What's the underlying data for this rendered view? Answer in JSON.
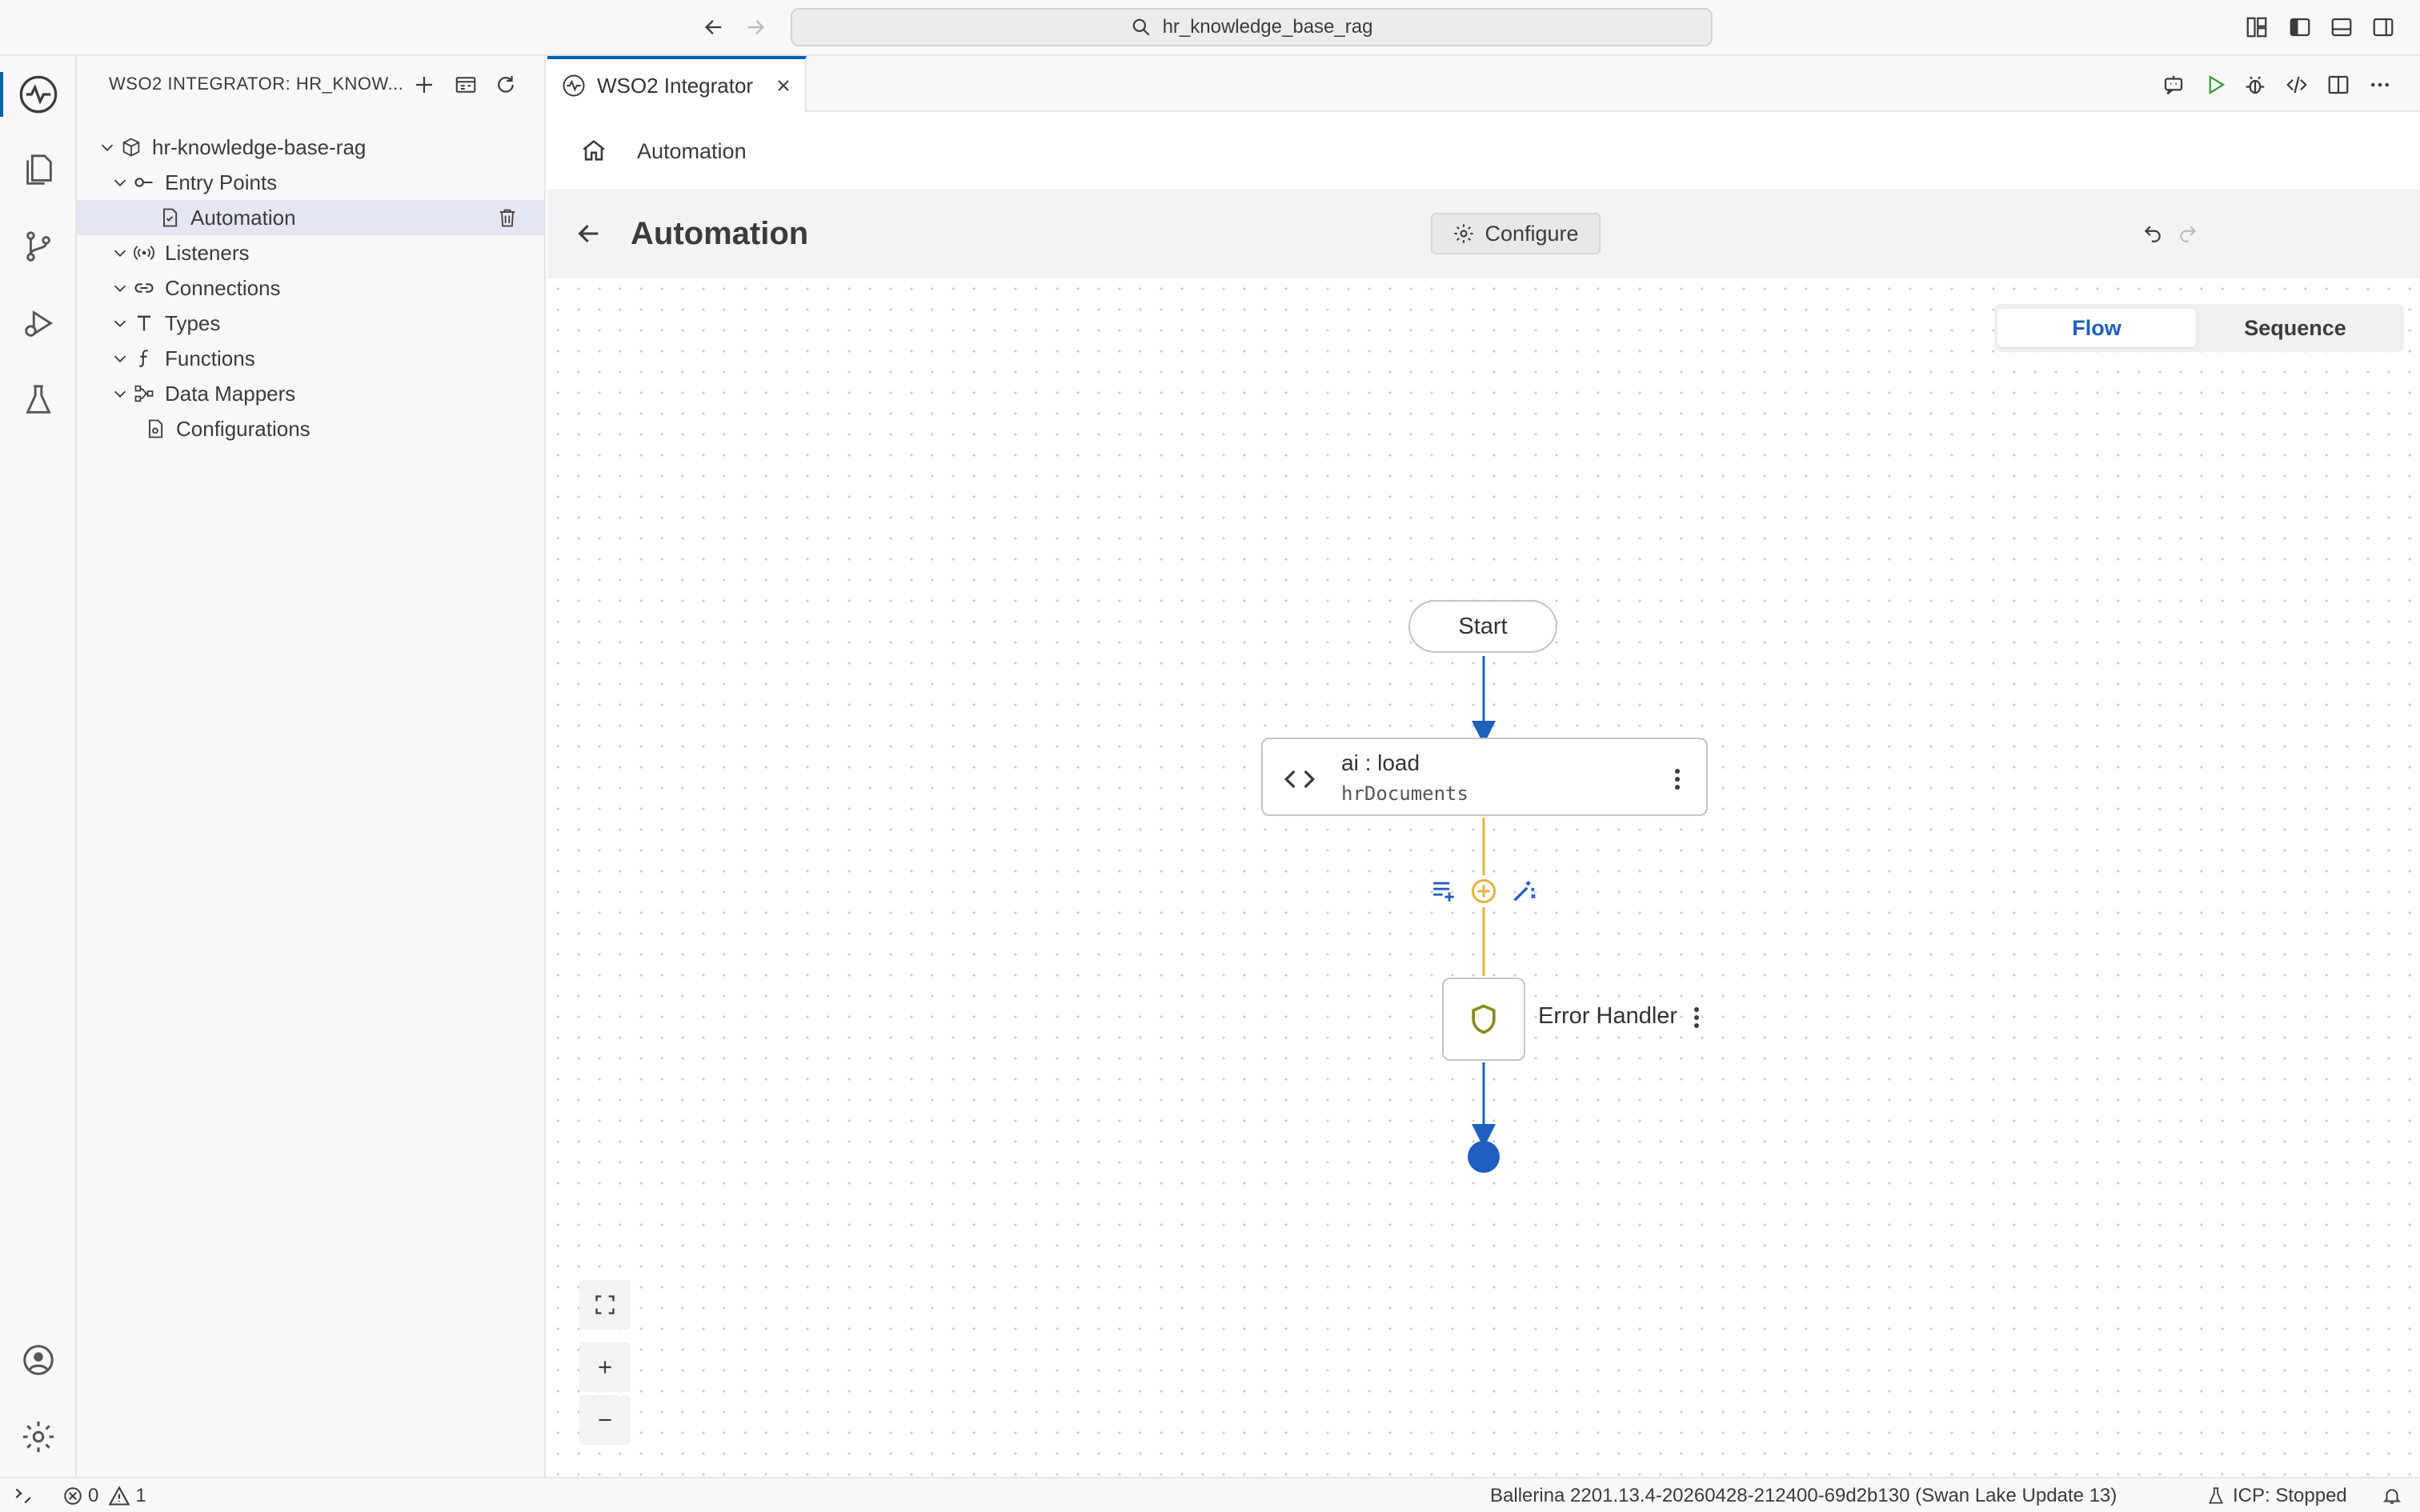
{
  "titlebar": {
    "search_text": "hr_knowledge_base_rag",
    "icons": [
      "arrow-left-icon",
      "arrow-right-icon",
      "search-icon",
      "customize-layout-icon",
      "toggle-primary-sidebar-icon",
      "toggle-panel-icon",
      "toggle-secondary-sidebar-icon"
    ]
  },
  "activitybar": {
    "items": [
      "wso2-integrator-icon",
      "explorer-icon",
      "source-control-icon",
      "run-debug-icon",
      "testing-icon"
    ],
    "bottom": [
      "accounts-icon",
      "settings-gear-icon"
    ]
  },
  "sidebar": {
    "title": "WSO2 INTEGRATOR: HR_KNOW...",
    "actions": [
      "add-icon",
      "open-overview-icon",
      "refresh-icon"
    ],
    "tree": {
      "project": "hr-knowledge-base-rag",
      "items": [
        {
          "label": "Entry Points",
          "icon": "entry-points-icon"
        },
        {
          "label": "Automation",
          "icon": "automation-file-icon"
        },
        {
          "label": "Listeners",
          "icon": "listeners-icon"
        },
        {
          "label": "Connections",
          "icon": "connections-icon"
        },
        {
          "label": "Types",
          "icon": "types-icon"
        },
        {
          "label": "Functions",
          "icon": "functions-icon"
        },
        {
          "label": "Data Mappers",
          "icon": "data-mappers-icon"
        },
        {
          "label": "Configurations",
          "icon": "configurations-icon"
        }
      ]
    }
  },
  "editor": {
    "tab_label": "WSO2 Integrator",
    "breadcrumb": "Automation",
    "title": "Automation",
    "configure_label": "Configure",
    "view_toggle": {
      "flow": "Flow",
      "sequence": "Sequence",
      "active": "Flow"
    }
  },
  "flow": {
    "start_label": "Start",
    "action_title": "ai : load",
    "action_subtitle": "hrDocuments",
    "error_handler_label": "Error Handler",
    "colors": {
      "main_line": "#1f5fbf",
      "error_line": "#e0b441",
      "end_node": "#1f5fbf",
      "shield": "#8a8a16"
    }
  },
  "statusbar": {
    "errors": "0",
    "warnings": "1",
    "ballerina": "Ballerina 2201.13.4-20260428-212400-69d2b130 (Swan Lake Update 13)",
    "icp": "ICP: Stopped"
  }
}
